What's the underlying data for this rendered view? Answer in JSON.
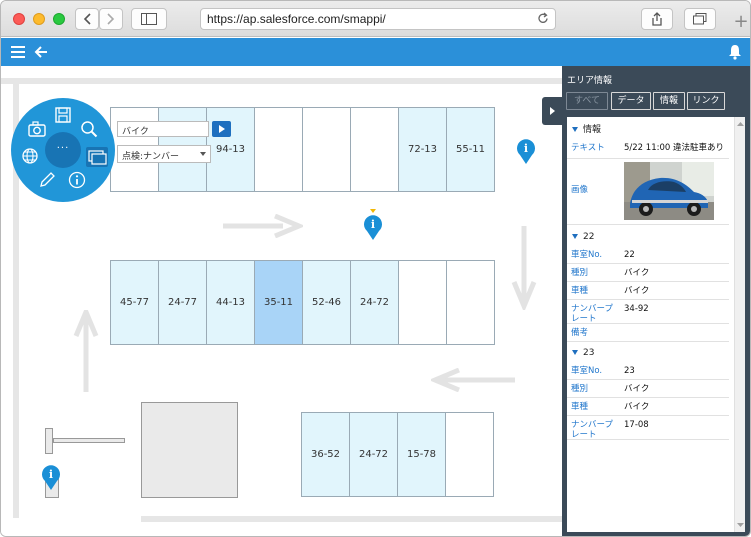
{
  "browser": {
    "url": "https://ap.salesforce.com/smappi/"
  },
  "search": {
    "query": "バイク",
    "filter_selected": "点検:ナンバー"
  },
  "map": {
    "top_row": [
      {
        "label": "",
        "highlight": "none"
      },
      {
        "label": "",
        "highlight": "light"
      },
      {
        "label": "94-13",
        "highlight": "light"
      },
      {
        "label": "",
        "highlight": "none"
      },
      {
        "label": "",
        "highlight": "none"
      },
      {
        "label": "",
        "highlight": "none"
      },
      {
        "label": "72-13",
        "highlight": "light"
      },
      {
        "label": "55-11",
        "highlight": "light"
      }
    ],
    "middle_row": [
      {
        "label": "45-77",
        "highlight": "light"
      },
      {
        "label": "24-77",
        "highlight": "light"
      },
      {
        "label": "44-13",
        "highlight": "light"
      },
      {
        "label": "35-11",
        "highlight": "selected"
      },
      {
        "label": "52-46",
        "highlight": "light"
      },
      {
        "label": "24-72",
        "highlight": "light"
      },
      {
        "label": "",
        "highlight": "none"
      },
      {
        "label": "",
        "highlight": "none"
      }
    ],
    "bottom_row": [
      {
        "label": "36-52",
        "highlight": "light"
      },
      {
        "label": "24-72",
        "highlight": "light"
      },
      {
        "label": "15-78",
        "highlight": "light"
      },
      {
        "label": "",
        "highlight": "none"
      }
    ]
  },
  "panel": {
    "title": "エリア情報",
    "tabs": [
      "すべて",
      "データ",
      "情報",
      "リンク"
    ],
    "info_section": {
      "title": "情報",
      "rows": [
        {
          "key": "テキスト",
          "value": "5/22 11:00 違法駐車あり"
        },
        {
          "key": "画像",
          "value": ""
        }
      ]
    },
    "sections": [
      {
        "title": "22",
        "rows": [
          {
            "key": "車室No.",
            "value": "22"
          },
          {
            "key": "種別",
            "value": "バイク"
          },
          {
            "key": "車種",
            "value": "バイク"
          },
          {
            "key": "ナンバープレート",
            "value": "34-92"
          },
          {
            "key": "備考",
            "value": ""
          }
        ]
      },
      {
        "title": "23",
        "rows": [
          {
            "key": "車室No.",
            "value": "23"
          },
          {
            "key": "種別",
            "value": "バイク"
          },
          {
            "key": "車種",
            "value": "バイク"
          },
          {
            "key": "ナンバープレート",
            "value": "17-08"
          }
        ]
      }
    ]
  },
  "colors": {
    "appbar": "#2b90d9",
    "slot_light": "#e1f5fc",
    "slot_selected": "#a9d4f7",
    "panel_bg": "#3b4a58",
    "radial": "#2196d8",
    "link": "#2277cc"
  },
  "icons": [
    "hamburger-icon",
    "back-arrow-icon",
    "bell-icon",
    "camera-icon",
    "save-icon",
    "search-icon",
    "globe-icon",
    "more-icon",
    "windows-icon",
    "pencil-icon",
    "info-icon",
    "play-icon",
    "info-pin-icon"
  ]
}
